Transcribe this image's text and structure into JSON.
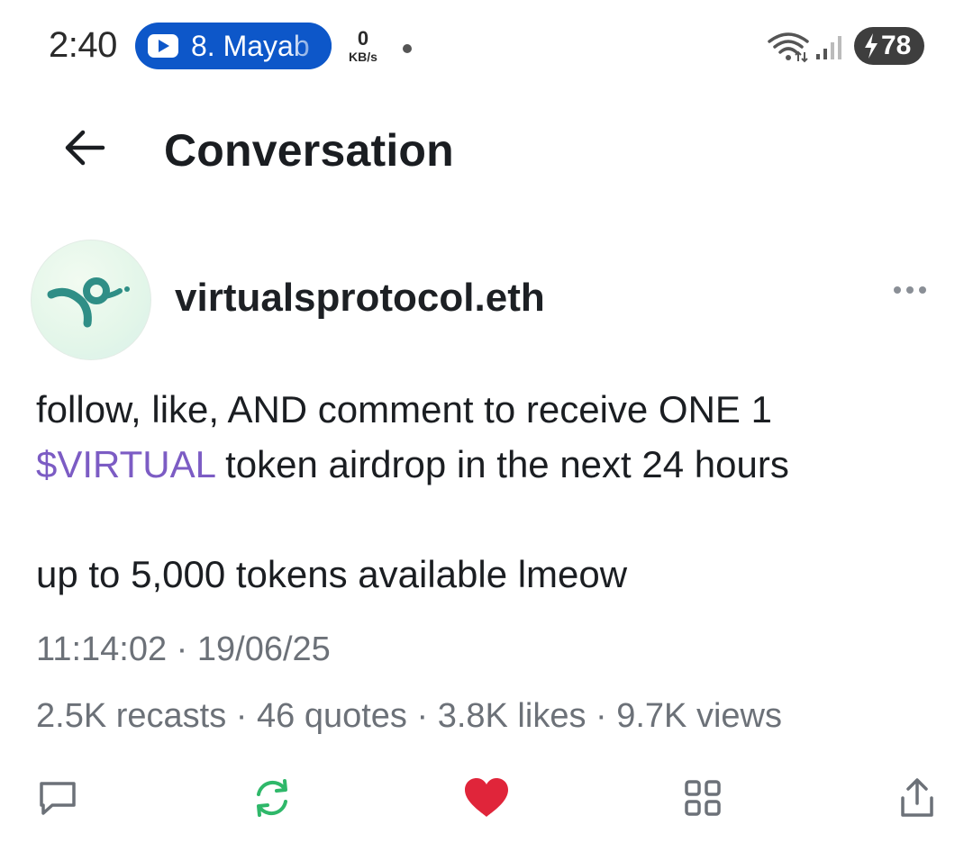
{
  "status_bar": {
    "time": "2:40",
    "media_label": "8. Mayab",
    "net_speed_value": "0",
    "net_speed_unit": "KB/s",
    "battery_level": "78",
    "icons": [
      "play-icon",
      "wifi-icon",
      "signal-icon",
      "battery-charging-icon"
    ]
  },
  "header": {
    "title": "Conversation",
    "back_icon": "arrow-left-icon"
  },
  "post": {
    "author": "virtualsprotocol.eth",
    "menu_icon": "more-horizontal-icon",
    "line1": "follow, like, AND comment to receive ONE 1",
    "cashtag": "$VIRTUAL",
    "line2_rest": " token airdrop in the next 24 hours",
    "line3": "up to 5,000 tokens available lmeow",
    "timestamp": "11:14:02 · 19/06/25",
    "stats": {
      "recasts": "2.5K recasts",
      "quotes": "46 quotes",
      "likes": "3.8K likes",
      "views": "9.7K views",
      "separator": " · "
    }
  },
  "actions": [
    {
      "name": "reply-icon",
      "color": "#6c7178"
    },
    {
      "name": "recast-icon",
      "color": "#2fb86a"
    },
    {
      "name": "heart-icon",
      "color": "#e0253a",
      "active": true
    },
    {
      "name": "apps-icon",
      "color": "#6c7178"
    },
    {
      "name": "share-icon",
      "color": "#6c7178"
    }
  ],
  "colors": {
    "cashtag": "#7c5cc4",
    "recast_green": "#2fb86a",
    "like_red": "#e0253a",
    "media_blue": "#0d57c9"
  }
}
